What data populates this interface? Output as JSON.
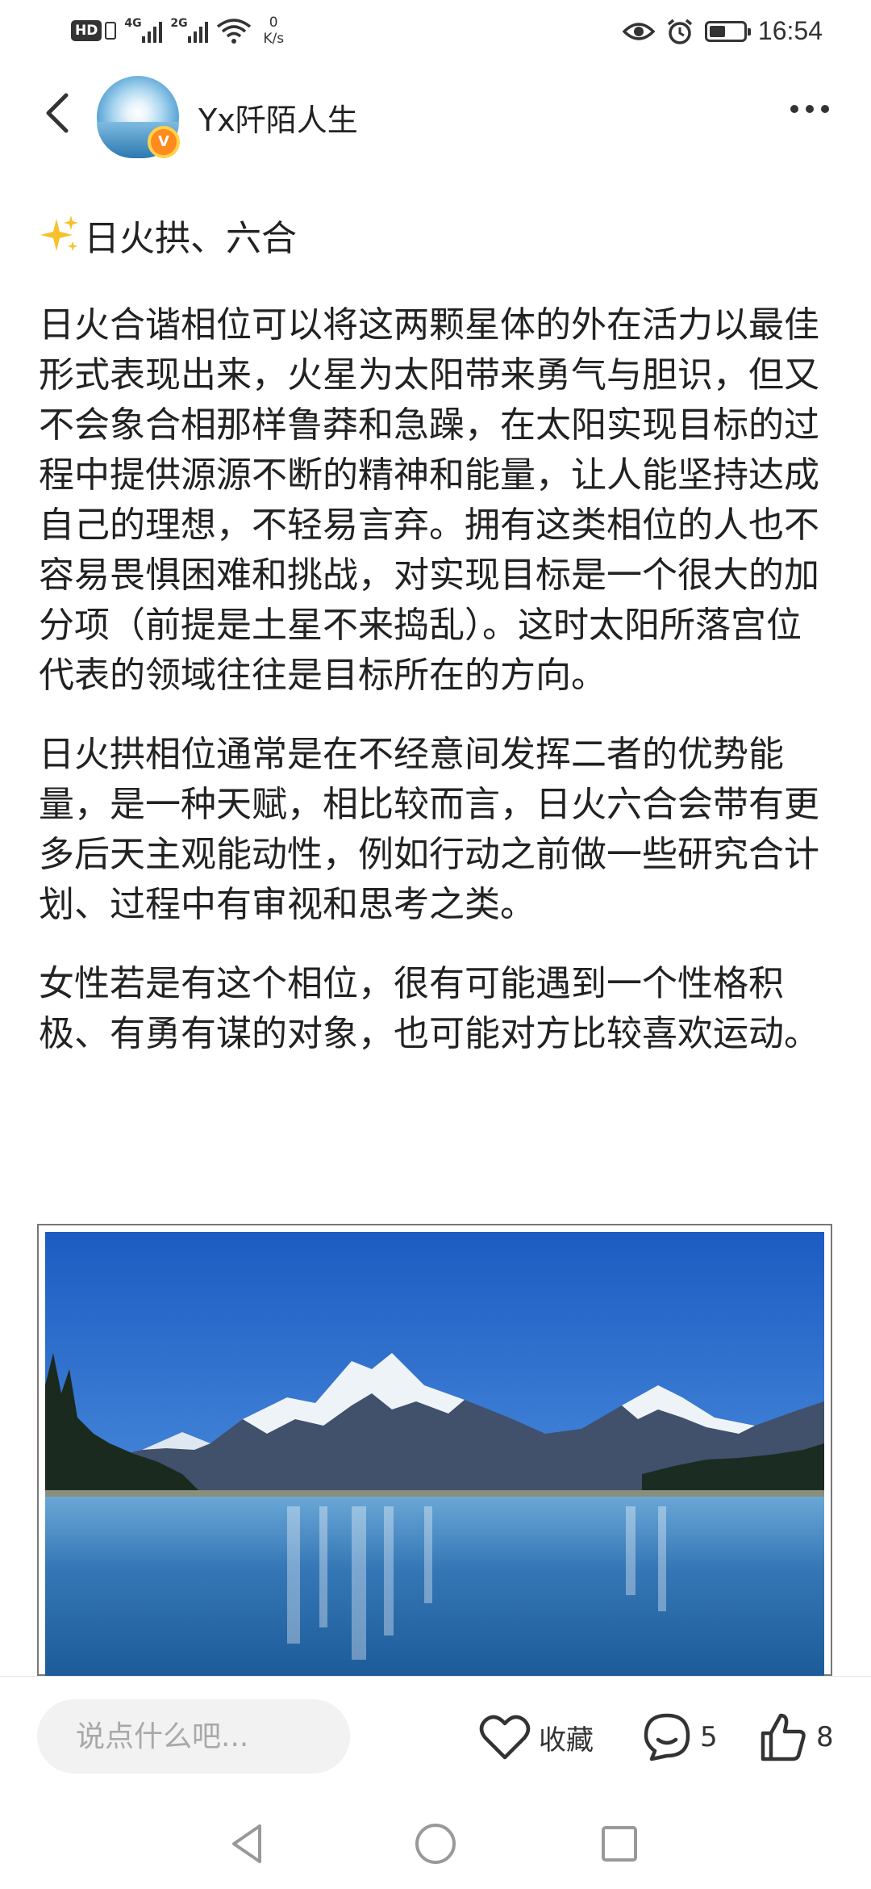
{
  "status_bar": {
    "hd": "HD",
    "sim1": "4G",
    "sim2": "2G",
    "speed_value": "0",
    "speed_unit": "K/s",
    "time": "16:54",
    "battery_level": 0.55,
    "icons": [
      "hd-icon",
      "sim-icon",
      "signal-icon",
      "wifi-icon",
      "eye-icon",
      "alarm-icon",
      "battery-icon"
    ]
  },
  "header": {
    "username": "Yx阡陌人生",
    "badge": "V",
    "icons": [
      "back-arrow-icon",
      "avatar",
      "more-icon"
    ]
  },
  "article": {
    "title": "日火拱、六合",
    "title_icon": "sparkles-icon",
    "paragraphs": [
      "日火合谐相位可以将这两颗星体的外在活力以最佳形式表现出来，火星为太阳带来勇气与胆识，但又不会象合相那样鲁莽和急躁，在太阳实现目标的过程中提供源源不断的精神和能量，让人能坚持达成自己的理想，不轻易言弃。拥有这类相位的人也不容易畏惧困难和挑战，对实现目标是一个很大的加分项（前提是土星不来捣乱）。这时太阳所落宫位代表的领域往往是目标所在的方向。",
      "日火拱相位通常是在不经意间发挥二者的优势能量，是一种天赋，相比较而言，日火六合会带有更多后天主观能动性，例如行动之前做一些研究合计划、过程中有审视和思考之类。",
      "女性若是有这个相位，很有可能遇到一个性格积极、有勇有谋的对象，也可能对方比较喜欢运动。"
    ]
  },
  "actions": {
    "comment_placeholder": "说点什么吧...",
    "favorite_label": "收藏",
    "comment_count": "5",
    "like_count": "8"
  },
  "colors": {
    "sky_top": "#1f5fc4",
    "sky_bottom": "#5c9ee6",
    "lake": "#2b6fb3",
    "badge": "#ff8a1e"
  }
}
